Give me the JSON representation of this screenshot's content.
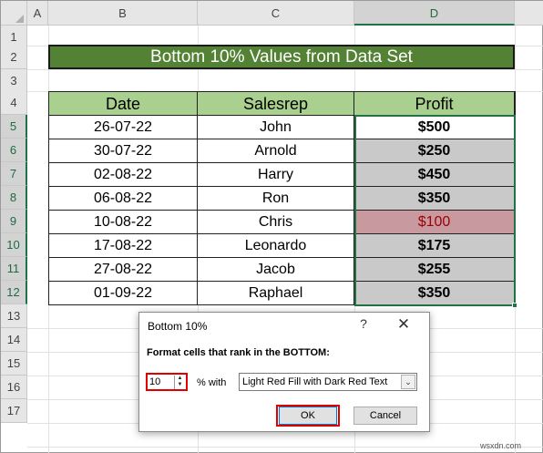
{
  "columns": [
    "A",
    "B",
    "C",
    "D"
  ],
  "rows": [
    "1",
    "2",
    "3",
    "4",
    "5",
    "6",
    "7",
    "8",
    "9",
    "10",
    "11",
    "12",
    "13",
    "14",
    "15",
    "16",
    "17"
  ],
  "title": "Bottom 10% Values from Data Set",
  "table": {
    "headers": [
      "Date",
      "Salesrep",
      "Profit"
    ],
    "rows": [
      {
        "date": "26-07-22",
        "salesrep": "John",
        "profit": "$500"
      },
      {
        "date": "30-07-22",
        "salesrep": "Arnold",
        "profit": "$250"
      },
      {
        "date": "02-08-22",
        "salesrep": "Harry",
        "profit": "$450"
      },
      {
        "date": "06-08-22",
        "salesrep": "Ron",
        "profit": "$350"
      },
      {
        "date": "10-08-22",
        "salesrep": "Chris",
        "profit": "$100"
      },
      {
        "date": "17-08-22",
        "salesrep": "Leonardo",
        "profit": "$175"
      },
      {
        "date": "27-08-22",
        "salesrep": "Jacob",
        "profit": "$255"
      },
      {
        "date": "01-09-22",
        "salesrep": "Raphael",
        "profit": "$350"
      }
    ]
  },
  "dialog": {
    "title": "Bottom 10%",
    "help": "?",
    "close": "✕",
    "label": "Format cells that rank in the BOTTOM:",
    "rank_value": "10",
    "percent_with": "% with",
    "format_option": "Light Red Fill with Dark Red Text",
    "ok": "OK",
    "cancel": "Cancel"
  },
  "watermark": "wsxdn.com",
  "colors": {
    "title_fill": "#548235",
    "header_fill": "#a9d08e",
    "highlight_fill": "#c9c9c9",
    "red_fill": "#c89aa0",
    "red_text": "#9c0006",
    "selection": "#217346",
    "callout": "#e00000"
  }
}
